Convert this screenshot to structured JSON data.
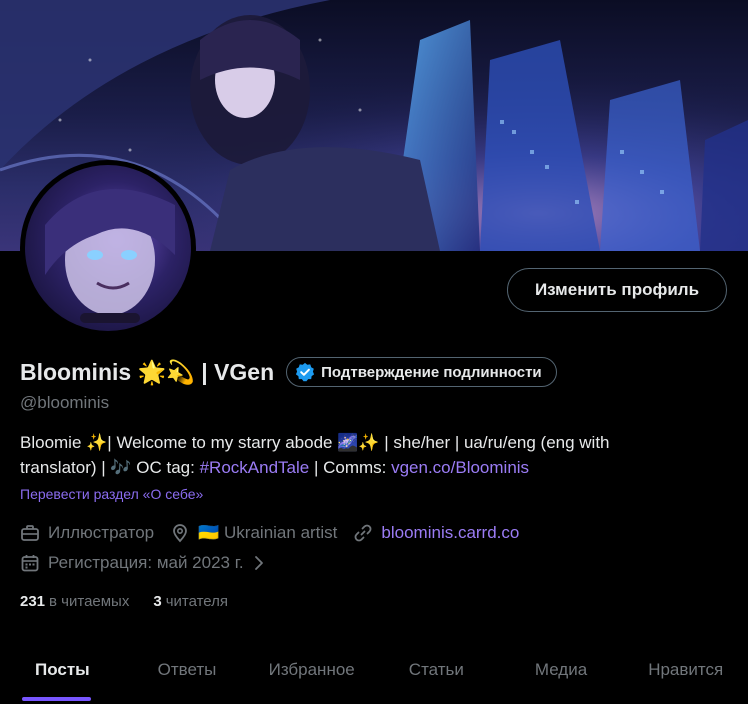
{
  "profile": {
    "display_name": "Bloominis 🌟💫 | VGen",
    "verify_label": "Подтверждение подлинности",
    "handle": "@bloominis",
    "edit_button": "Изменить профиль",
    "bio_line1_prefix": "Bloomie ✨| Welcome to my starry abode 🌌✨ | she/her | ua/ru/eng (eng with",
    "bio_line2_prefix": "translator) | 🎶 OC tag: ",
    "bio_hashtag": "#RockAndTale",
    "bio_line2_mid": " | Comms: ",
    "bio_link": "vgen.co/Bloominis",
    "translate_label": "Перевести раздел «О себе»",
    "profession": "Иллюстратор",
    "location": "🇺🇦 Ukrainian artist",
    "website": "bloominis.carrd.co",
    "joined": "Регистрация: май 2023 г.",
    "following_count": "231",
    "following_label": "в читаемых",
    "followers_count": "3",
    "followers_label": "читателя"
  },
  "tabs": [
    {
      "label": "Посты",
      "active": true
    },
    {
      "label": "Ответы",
      "active": false
    },
    {
      "label": "Избранное",
      "active": false
    },
    {
      "label": "Статьи",
      "active": false
    },
    {
      "label": "Медиа",
      "active": false
    },
    {
      "label": "Нравится",
      "active": false
    }
  ],
  "colors": {
    "background": "#000000",
    "text": "#e7e9ea",
    "muted": "#71767b",
    "link": "#9b7cf5",
    "accent": "#7856ff",
    "verified": "#1d9bf0"
  },
  "icons": {
    "profession": "briefcase-icon",
    "location": "location-pin-icon",
    "website": "link-icon",
    "joined": "calendar-icon",
    "verified": "verified-badge-icon",
    "joined_more": "chevron-right-icon"
  }
}
